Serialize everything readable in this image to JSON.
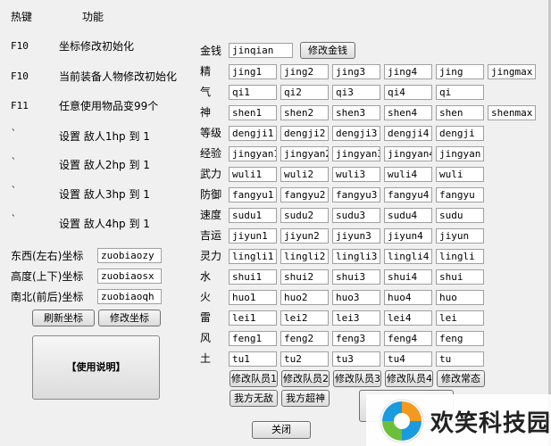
{
  "header": {
    "hotkey": "热键",
    "function": "功能"
  },
  "hotkeys": [
    {
      "key": "F10",
      "desc": "坐标修改初始化"
    },
    {
      "key": "F10",
      "desc": "当前装备人物修改初始化"
    },
    {
      "key": "F11",
      "desc": "任意使用物品变99个"
    },
    {
      "key": "`",
      "desc": "设置 敌人1hp 到 1"
    },
    {
      "key": "`",
      "desc": "设置 敌人2hp 到 1"
    },
    {
      "key": "`",
      "desc": "设置 敌人3hp 到 1"
    },
    {
      "key": "`",
      "desc": "设置 敌人4hp 到 1"
    }
  ],
  "coords": [
    {
      "label": "东西(左右)坐标",
      "value": "zuobiaozy"
    },
    {
      "label": "高度(上下)坐标",
      "value": "zuobiaosx"
    },
    {
      "label": "南北(前后)坐标",
      "value": "zuobiaoqh"
    }
  ],
  "buttons": {
    "refresh_coords": "刷新坐标",
    "modify_coords": "修改坐标",
    "instructions": "【使用说明】",
    "modify_money": "修改金钱",
    "close": "关闭",
    "modify_member1": "修改队员1",
    "modify_member2": "修改队员2",
    "modify_member3": "修改队员3",
    "modify_member4": "修改队员4",
    "modify_state": "修改常态",
    "invincible": "我方无敌",
    "super_god": "我方超神"
  },
  "money": {
    "label": "金钱",
    "value": "jinqian"
  },
  "stats": [
    {
      "label": "精",
      "values": [
        "jing1",
        "jing2",
        "jing3",
        "jing4",
        "jing",
        "jingmax"
      ]
    },
    {
      "label": "气",
      "values": [
        "qi1",
        "qi2",
        "qi3",
        "qi4",
        "qi"
      ]
    },
    {
      "label": "神",
      "values": [
        "shen1",
        "shen2",
        "shen3",
        "shen4",
        "shen",
        "shenmax"
      ]
    },
    {
      "label": "等级",
      "values": [
        "dengji1",
        "dengji2",
        "dengji3",
        "dengji4",
        "dengji"
      ]
    },
    {
      "label": "经验",
      "values": [
        "jingyan1",
        "jingyan2",
        "jingyan3",
        "jingyan4",
        "jingyan"
      ]
    },
    {
      "label": "武力",
      "values": [
        "wuli1",
        "wuli2",
        "wuli3",
        "wuli4",
        "wuli"
      ]
    },
    {
      "label": "防御",
      "values": [
        "fangyu1",
        "fangyu2",
        "fangyu3",
        "fangyu4",
        "fangyu"
      ]
    },
    {
      "label": "速度",
      "values": [
        "sudu1",
        "sudu2",
        "sudu3",
        "sudu4",
        "sudu"
      ]
    },
    {
      "label": "吉运",
      "values": [
        "jiyun1",
        "jiyun2",
        "jiyun3",
        "jiyun4",
        "jiyun"
      ]
    },
    {
      "label": "灵力",
      "values": [
        "lingli1",
        "lingli2",
        "lingli3",
        "lingli4",
        "lingli"
      ]
    },
    {
      "label": "水",
      "values": [
        "shui1",
        "shui2",
        "shui3",
        "shui4",
        "shui"
      ]
    },
    {
      "label": "火",
      "values": [
        "huo1",
        "huo2",
        "huo3",
        "huo4",
        "huo"
      ]
    },
    {
      "label": "雷",
      "values": [
        "lei1",
        "lei2",
        "lei3",
        "lei4",
        "lei"
      ]
    },
    {
      "label": "风",
      "values": [
        "feng1",
        "feng2",
        "feng3",
        "feng4",
        "feng"
      ]
    },
    {
      "label": "土",
      "values": [
        "tu1",
        "tu2",
        "tu3",
        "tu4",
        "tu"
      ]
    }
  ],
  "watermark": {
    "text": "欢笑科技园",
    "colors": {
      "orange": "#f39a1e",
      "blue": "#1a9be0",
      "green": "#6cbf3a"
    }
  }
}
